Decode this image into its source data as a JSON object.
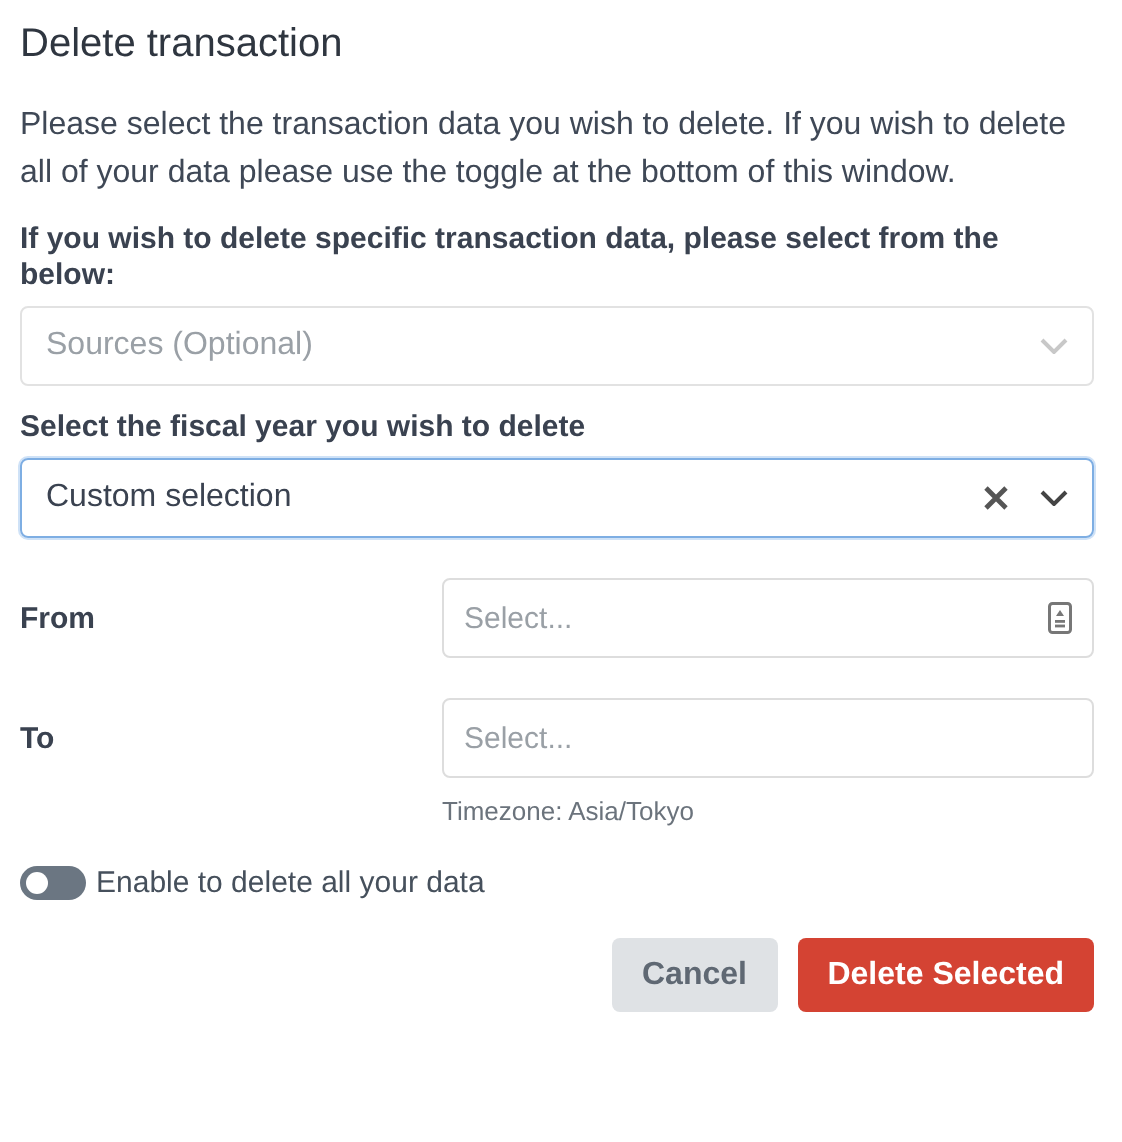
{
  "dialog": {
    "title": "Delete transaction",
    "intro": "Please select the transaction data you wish to delete. If you wish to delete all of your data please use the toggle at the bottom of this window.",
    "sources": {
      "label": "If you wish to delete specific transaction data, please select from the below:",
      "placeholder": "Sources (Optional)",
      "disabled": true
    },
    "fiscal_year": {
      "label": "Select the fiscal year you wish to delete",
      "value": "Custom selection",
      "focused": true,
      "clearable": true
    },
    "range": [
      {
        "label": "From",
        "placeholder": "Select...",
        "kind": "calendar"
      },
      {
        "label": "To",
        "placeholder": "Select...",
        "kind": "plain"
      }
    ],
    "timezone": "Timezone: Asia/Tokyo",
    "toggle": {
      "label": "Enable to delete all your data",
      "on": false
    },
    "buttons": [
      {
        "label": "Cancel",
        "kind": "secondary"
      },
      {
        "label": "Delete Selected",
        "kind": "danger"
      }
    ]
  }
}
